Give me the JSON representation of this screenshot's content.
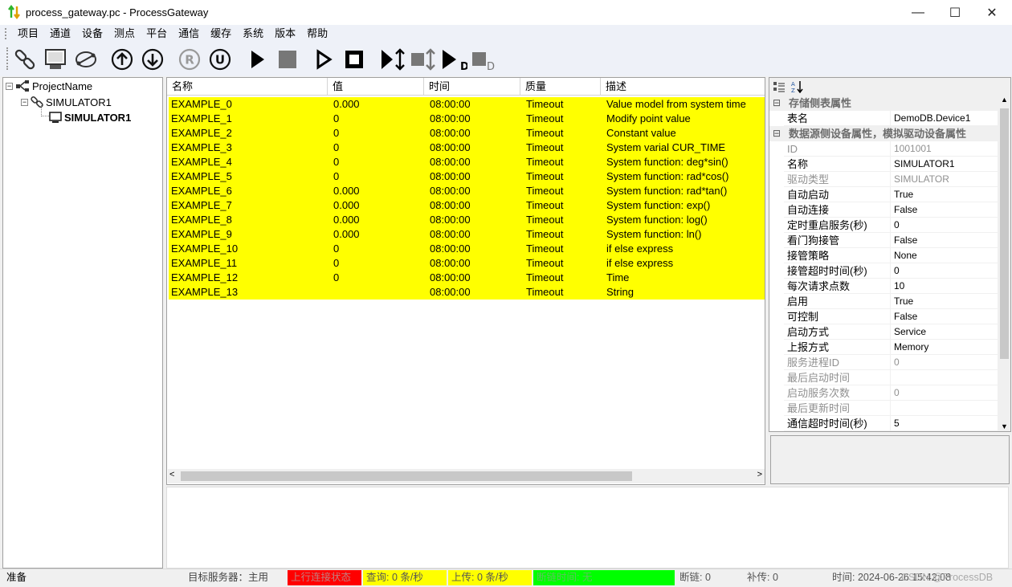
{
  "window": {
    "title": "process_gateway.pc - ProcessGateway",
    "minimize": "—",
    "maximize": "☐",
    "close": "✕"
  },
  "menu": [
    "项目",
    "通道",
    "设备",
    "测点",
    "平台",
    "通信",
    "缓存",
    "系统",
    "版本",
    "帮助"
  ],
  "toolbar": {
    "icons": [
      "link-icon",
      "monitor-icon",
      "connection-icon",
      "upload-icon",
      "download-icon",
      "registered-icon",
      "unregister-icon",
      "play-icon",
      "stop-icon",
      "run-icon",
      "halt-icon",
      "run-all-icon",
      "stop-all-icon",
      "debug-run-icon",
      "debug-stop-icon"
    ]
  },
  "tree": {
    "root": "ProjectName",
    "channel": "SIMULATOR1",
    "device": "SIMULATOR1"
  },
  "grid": {
    "columns": [
      "名称",
      "值",
      "时间",
      "质量",
      "描述"
    ],
    "rows": [
      {
        "name": "EXAMPLE_0",
        "value": "0.000",
        "time": "08:00:00",
        "quality": "Timeout",
        "desc": "Value model from system time"
      },
      {
        "name": "EXAMPLE_1",
        "value": "0",
        "time": "08:00:00",
        "quality": "Timeout",
        "desc": "Modify point value"
      },
      {
        "name": "EXAMPLE_2",
        "value": "0",
        "time": "08:00:00",
        "quality": "Timeout",
        "desc": "Constant value"
      },
      {
        "name": "EXAMPLE_3",
        "value": "0",
        "time": "08:00:00",
        "quality": "Timeout",
        "desc": "System varial CUR_TIME"
      },
      {
        "name": "EXAMPLE_4",
        "value": "0",
        "time": "08:00:00",
        "quality": "Timeout",
        "desc": "System function: deg*sin()"
      },
      {
        "name": "EXAMPLE_5",
        "value": "0",
        "time": "08:00:00",
        "quality": "Timeout",
        "desc": "System function: rad*cos()"
      },
      {
        "name": "EXAMPLE_6",
        "value": "0.000",
        "time": "08:00:00",
        "quality": "Timeout",
        "desc": "System function: rad*tan()"
      },
      {
        "name": "EXAMPLE_7",
        "value": "0.000",
        "time": "08:00:00",
        "quality": "Timeout",
        "desc": "System function: exp()"
      },
      {
        "name": "EXAMPLE_8",
        "value": "0.000",
        "time": "08:00:00",
        "quality": "Timeout",
        "desc": "System function: log()"
      },
      {
        "name": "EXAMPLE_9",
        "value": "0.000",
        "time": "08:00:00",
        "quality": "Timeout",
        "desc": "System function: ln()"
      },
      {
        "name": "EXAMPLE_10",
        "value": "0",
        "time": "08:00:00",
        "quality": "Timeout",
        "desc": "if else express"
      },
      {
        "name": "EXAMPLE_11",
        "value": "0",
        "time": "08:00:00",
        "quality": "Timeout",
        "desc": "if else express"
      },
      {
        "name": "EXAMPLE_12",
        "value": "0",
        "time": "08:00:00",
        "quality": "Timeout",
        "desc": "Time"
      },
      {
        "name": "EXAMPLE_13",
        "value": "",
        "time": "08:00:00",
        "quality": "Timeout",
        "desc": "String"
      }
    ],
    "row_color": "#ffff00"
  },
  "props": {
    "cat1": "存储侧表属性",
    "cat2": "数据源侧设备属性，模拟驱动设备属性",
    "rows1": [
      {
        "name": "表名",
        "value": "DemoDB.Device1",
        "disabled": false
      }
    ],
    "rows2": [
      {
        "name": "ID",
        "value": "1001001",
        "disabled": true
      },
      {
        "name": "名称",
        "value": "SIMULATOR1",
        "disabled": false
      },
      {
        "name": "驱动类型",
        "value": "SIMULATOR",
        "disabled": true
      },
      {
        "name": "自动启动",
        "value": "True",
        "disabled": false
      },
      {
        "name": "自动连接",
        "value": "False",
        "disabled": false
      },
      {
        "name": "定时重启服务(秒)",
        "value": "0",
        "disabled": false
      },
      {
        "name": "看门狗接管",
        "value": "False",
        "disabled": false
      },
      {
        "name": "接管策略",
        "value": "None",
        "disabled": false
      },
      {
        "name": "接管超时时间(秒)",
        "value": "0",
        "disabled": false
      },
      {
        "name": "每次请求点数",
        "value": "10",
        "disabled": false
      },
      {
        "name": "启用",
        "value": "True",
        "disabled": false
      },
      {
        "name": "可控制",
        "value": "False",
        "disabled": false
      },
      {
        "name": "启动方式",
        "value": "Service",
        "disabled": false
      },
      {
        "name": "上报方式",
        "value": "Memory",
        "disabled": false
      },
      {
        "name": "服务进程ID",
        "value": "0",
        "disabled": true
      },
      {
        "name": "最后启动时间",
        "value": "",
        "disabled": true
      },
      {
        "name": "启动服务次数",
        "value": "0",
        "disabled": true
      },
      {
        "name": "最后更新时间",
        "value": "",
        "disabled": true
      },
      {
        "name": "通信超时时间(秒)",
        "value": "5",
        "disabled": false
      }
    ]
  },
  "status": {
    "ready": "准备",
    "target": "目标服务器：主用",
    "uplink": "上行连接状态",
    "query": "查询:    0 条/秒",
    "upload": "上传:    0 条/秒",
    "disconnect_time": "断链时间: 无",
    "disconnect": "断链: 0",
    "resend": "补传: 0",
    "time": "时间: 2024-06-26 15:42:08",
    "watermark": "CSDN @ProcessDB",
    "uplink_color": "#ff0000",
    "query_color": "#ffff00",
    "upload_color": "#ffff00",
    "disconnect_color": "#00ff00"
  }
}
